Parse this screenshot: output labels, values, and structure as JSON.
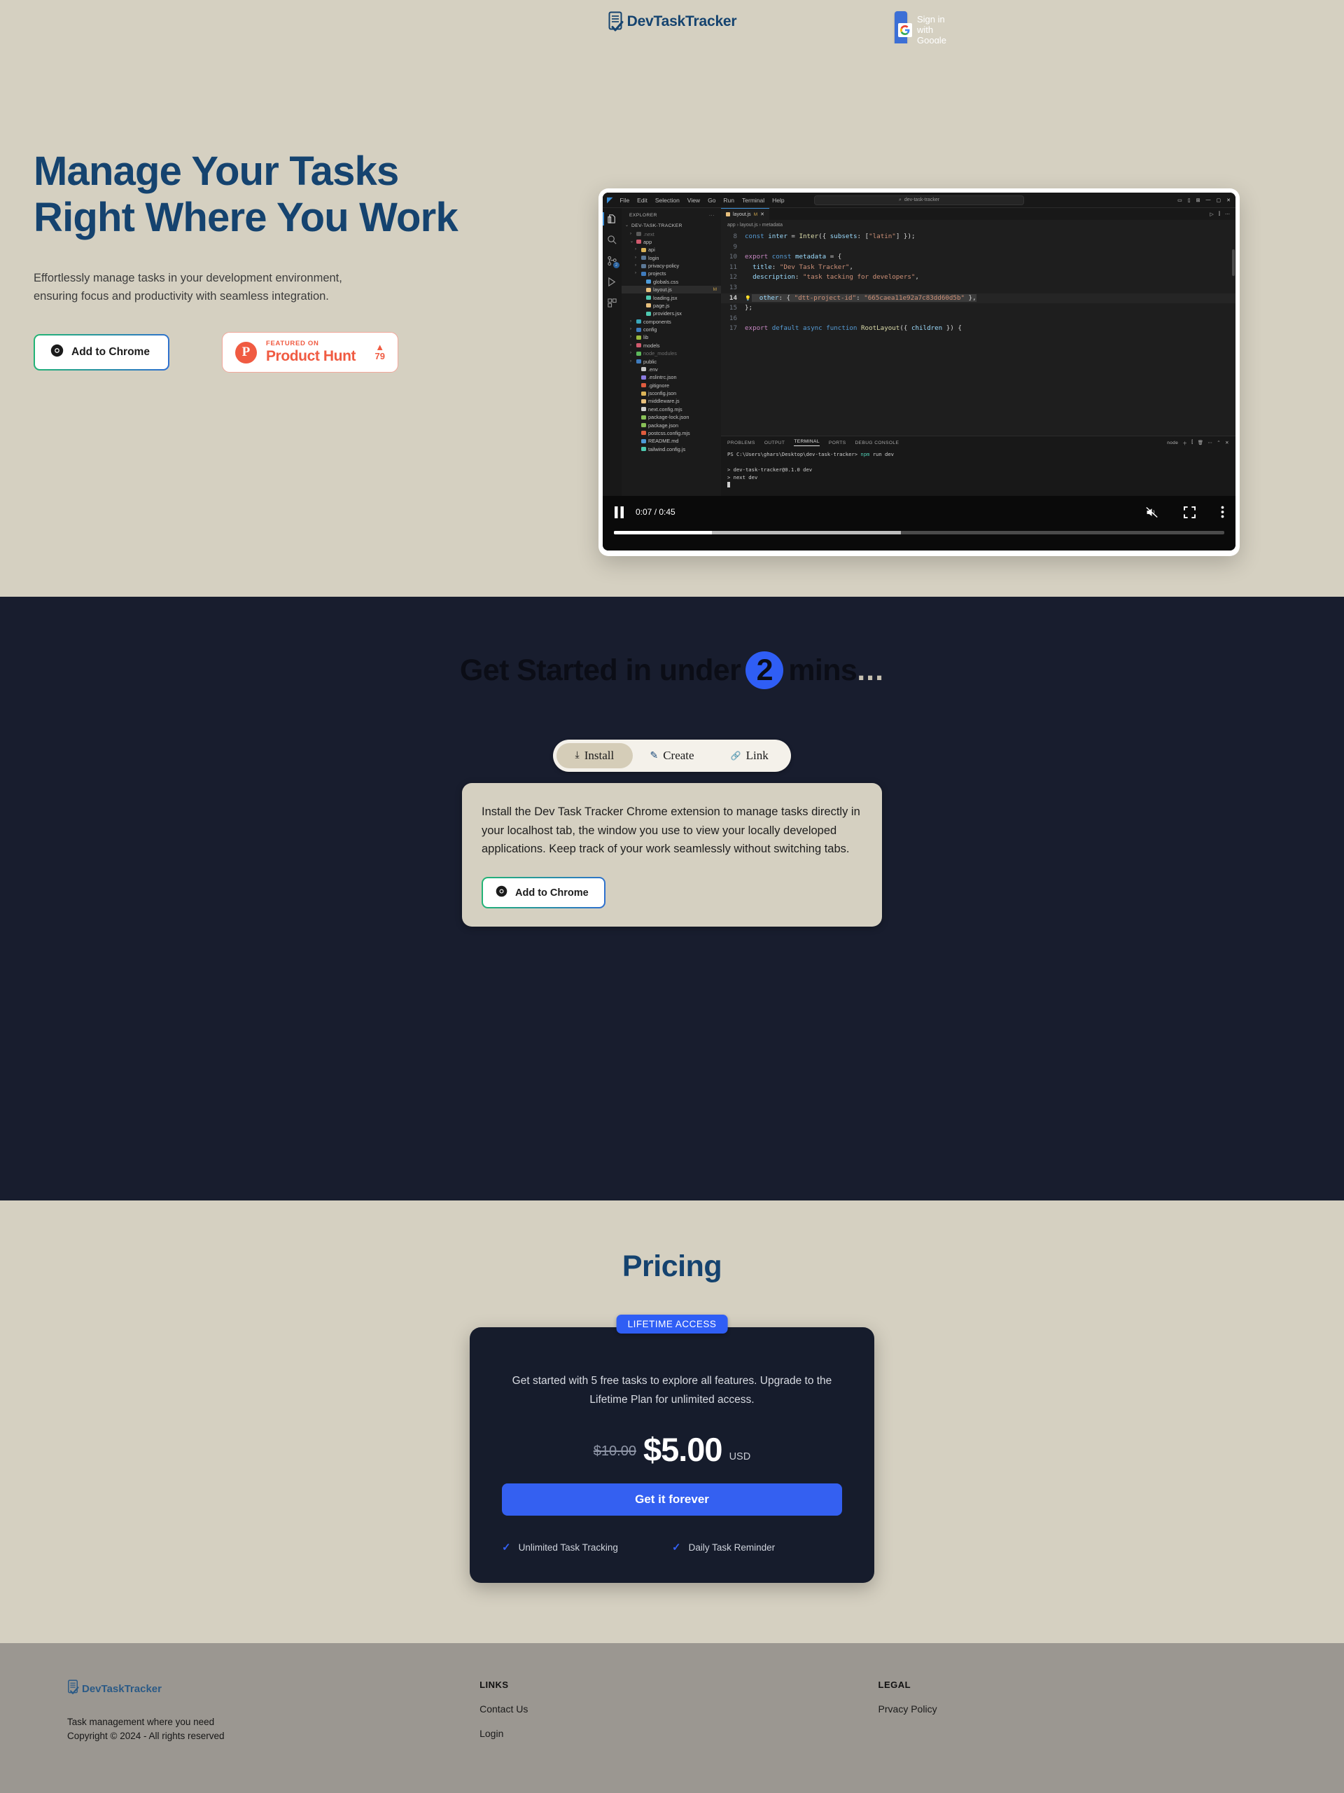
{
  "header": {
    "brand": "DevTaskTracker",
    "google_button": "Sign in with Google"
  },
  "hero": {
    "title_line1": "Manage Your Tasks",
    "title_line2": "Right Where You Work",
    "subtitle_line1": "Effortlessly manage tasks in your development environment,",
    "subtitle_line2": "ensuring focus and productivity with seamless integration.",
    "chrome_button": "Add to Chrome",
    "product_hunt": {
      "featured_on": "FEATURED ON",
      "name": "Product Hunt",
      "votes": "79",
      "triangle": "▲"
    }
  },
  "video": {
    "time": "0:07 / 0:45",
    "played_percent": 16,
    "buffered_percent": 47,
    "editor": {
      "menu": [
        "File",
        "Edit",
        "Selection",
        "View",
        "Go",
        "Run",
        "Terminal",
        "Help"
      ],
      "search_placeholder": "dev-task-tracker",
      "explorer_label": "EXPLORER",
      "explorer_more": "···",
      "root": "DEV-TASK-TRACKER",
      "tree": [
        {
          "indent": 1,
          "chev": "›",
          "color": "#5a5a5a",
          "label": ".next",
          "dim": true,
          "mod": ""
        },
        {
          "indent": 1,
          "chev": "⌄",
          "color": "#d15a6e",
          "label": "app",
          "dim": false,
          "mod": ""
        },
        {
          "indent": 2,
          "chev": "›",
          "color": "#dcb457",
          "label": "api",
          "dim": false,
          "mod": ""
        },
        {
          "indent": 2,
          "chev": "›",
          "color": "#5b7896",
          "label": "login",
          "dim": false,
          "mod": ""
        },
        {
          "indent": 2,
          "chev": "›",
          "color": "#5b7896",
          "label": "privacy-policy",
          "dim": false,
          "mod": ""
        },
        {
          "indent": 2,
          "chev": "›",
          "color": "#3f7bbd",
          "label": "projects",
          "dim": false,
          "mod": ""
        },
        {
          "indent": 3,
          "chev": "",
          "color": "#4d9bd8",
          "label": "globals.css",
          "dim": false,
          "mod": ""
        },
        {
          "indent": 3,
          "chev": "",
          "color": "#e8c07d",
          "label": "layout.js",
          "dim": false,
          "mod": "M",
          "selected": true
        },
        {
          "indent": 3,
          "chev": "",
          "color": "#4ec9b0",
          "label": "loading.jsx",
          "dim": false,
          "mod": ""
        },
        {
          "indent": 3,
          "chev": "",
          "color": "#e8c07d",
          "label": "page.js",
          "dim": false,
          "mod": ""
        },
        {
          "indent": 3,
          "chev": "",
          "color": "#4ec9b0",
          "label": "providers.jsx",
          "dim": false,
          "mod": ""
        },
        {
          "indent": 1,
          "chev": "›",
          "color": "#3aa6b9",
          "label": "components",
          "dim": false,
          "mod": ""
        },
        {
          "indent": 1,
          "chev": "›",
          "color": "#3f7bbd",
          "label": "config",
          "dim": false,
          "mod": ""
        },
        {
          "indent": 1,
          "chev": "›",
          "color": "#9aba3e",
          "label": "lib",
          "dim": false,
          "mod": ""
        },
        {
          "indent": 1,
          "chev": "›",
          "color": "#d15a6e",
          "label": "models",
          "dim": false,
          "mod": ""
        },
        {
          "indent": 1,
          "chev": "›",
          "color": "#5cb85c",
          "label": "node_modules",
          "dim": true,
          "mod": ""
        },
        {
          "indent": 1,
          "chev": "›",
          "color": "#3f7bbd",
          "label": "public",
          "dim": false,
          "mod": ""
        },
        {
          "indent": 2,
          "chev": "",
          "color": "#c7c7c7",
          "label": ".env",
          "dim": false,
          "mod": ""
        },
        {
          "indent": 2,
          "chev": "",
          "color": "#8a7ae0",
          "label": ".eslintrc.json",
          "dim": false,
          "mod": ""
        },
        {
          "indent": 2,
          "chev": "",
          "color": "#e05c3e",
          "label": ".gitignore",
          "dim": false,
          "mod": ""
        },
        {
          "indent": 2,
          "chev": "",
          "color": "#dcb457",
          "label": "jsconfig.json",
          "dim": false,
          "mod": ""
        },
        {
          "indent": 2,
          "chev": "",
          "color": "#e8c07d",
          "label": "middleware.js",
          "dim": false,
          "mod": ""
        },
        {
          "indent": 2,
          "chev": "",
          "color": "#cfcfcf",
          "label": "next.config.mjs",
          "dim": false,
          "mod": ""
        },
        {
          "indent": 2,
          "chev": "",
          "color": "#88c057",
          "label": "package-lock.json",
          "dim": false,
          "mod": ""
        },
        {
          "indent": 2,
          "chev": "",
          "color": "#88c057",
          "label": "package.json",
          "dim": false,
          "mod": ""
        },
        {
          "indent": 2,
          "chev": "",
          "color": "#e05c3e",
          "label": "postcss.config.mjs",
          "dim": false,
          "mod": ""
        },
        {
          "indent": 2,
          "chev": "",
          "color": "#4d9bd8",
          "label": "README.md",
          "dim": false,
          "mod": ""
        },
        {
          "indent": 2,
          "chev": "",
          "color": "#4ec9b0",
          "label": "tailwind.config.js",
          "dim": false,
          "mod": ""
        }
      ],
      "tab_name": "layout.js",
      "tab_modified": "M",
      "tab_close": "✕",
      "breadcrumb": "app  ›  layout.js  ›  metadata",
      "code_lines": [
        {
          "n": "8",
          "segments": [
            {
              "t": "const ",
              "c": "kw"
            },
            {
              "t": "inter",
              "c": "v"
            },
            {
              "t": " = ",
              "c": "p"
            },
            {
              "t": "Inter",
              "c": "fn"
            },
            {
              "t": "({ ",
              "c": "p"
            },
            {
              "t": "subsets",
              "c": "v"
            },
            {
              "t": ": [",
              "c": "p"
            },
            {
              "t": "\"latin\"",
              "c": "s"
            },
            {
              "t": "] });",
              "c": "p"
            }
          ]
        },
        {
          "n": "9",
          "segments": []
        },
        {
          "n": "10",
          "segments": [
            {
              "t": "export ",
              "c": "k"
            },
            {
              "t": "const ",
              "c": "kw"
            },
            {
              "t": "metadata",
              "c": "v"
            },
            {
              "t": " = {",
              "c": "p"
            }
          ]
        },
        {
          "n": "11",
          "segments": [
            {
              "t": "  title",
              "c": "v"
            },
            {
              "t": ": ",
              "c": "p"
            },
            {
              "t": "\"Dev Task Tracker\"",
              "c": "s"
            },
            {
              "t": ",",
              "c": "p"
            }
          ]
        },
        {
          "n": "12",
          "segments": [
            {
              "t": "  description",
              "c": "v"
            },
            {
              "t": ": ",
              "c": "p"
            },
            {
              "t": "\"task tacking for developers\"",
              "c": "s"
            },
            {
              "t": ",",
              "c": "p"
            }
          ]
        },
        {
          "n": "13",
          "segments": []
        },
        {
          "n": "14",
          "current": true,
          "bulb": "●",
          "segments": [
            {
              "t": "  other",
              "c": "v hl"
            },
            {
              "t": ": { ",
              "c": "p hl"
            },
            {
              "t": "\"dtt-project-id\"",
              "c": "s hl"
            },
            {
              "t": ": ",
              "c": "p hl"
            },
            {
              "t": "\"665caea11e92a7c83dd60d5b\"",
              "c": "s hl"
            },
            {
              "t": " },",
              "c": "p hl"
            }
          ]
        },
        {
          "n": "15",
          "segments": [
            {
              "t": "};",
              "c": "p"
            }
          ]
        },
        {
          "n": "16",
          "segments": []
        },
        {
          "n": "17",
          "segments": [
            {
              "t": "export ",
              "c": "k"
            },
            {
              "t": "default ",
              "c": "kw"
            },
            {
              "t": "async ",
              "c": "kw"
            },
            {
              "t": "function ",
              "c": "kw"
            },
            {
              "t": "RootLayout",
              "c": "fn"
            },
            {
              "t": "({ ",
              "c": "p"
            },
            {
              "t": "children",
              "c": "v"
            },
            {
              "t": " }) {",
              "c": "p"
            }
          ]
        }
      ],
      "panel_tabs": [
        "PROBLEMS",
        "OUTPUT",
        "TERMINAL",
        "PORTS",
        "DEBUG CONSOLE"
      ],
      "panel_active": "TERMINAL",
      "panel_right": "node",
      "terminal_lines": [
        "PS C:\\Users\\ghars\\Desktop\\dev-task-tracker> npm run dev",
        "",
        "> dev-task-tracker@0.1.0 dev",
        "> next dev"
      ]
    }
  },
  "get_started": {
    "title_before": "Get Started in under",
    "highlight": "2",
    "title_after": "mins",
    "dots": "...",
    "tabs": [
      {
        "label": "Install",
        "icon": "download-icon",
        "glyph": "⤓",
        "active": true
      },
      {
        "label": "Create",
        "icon": "pencil-icon",
        "glyph": "✎",
        "active": false
      },
      {
        "label": "Link",
        "icon": "link-icon",
        "glyph": "🔗",
        "active": false
      }
    ],
    "panel_text": "Install the Dev Task Tracker Chrome extension to manage tasks directly in your localhost tab, the window you use to view your locally developed applications. Keep track of your work seamlessly without switching tabs.",
    "panel_button": "Add to Chrome"
  },
  "pricing": {
    "title": "Pricing",
    "badge": "LIFETIME ACCESS",
    "description": "Get started with 5 free tasks to explore all features. Upgrade to the Lifetime Plan for unlimited access.",
    "price_old": "$10.00",
    "price_new": "$5.00",
    "currency": "USD",
    "cta": "Get it forever",
    "features": [
      "Unlimited Task Tracking",
      "Daily Task Reminder"
    ],
    "check": "✓"
  },
  "footer": {
    "brand": "DevTaskTracker",
    "tagline_line1": "Task management where you need",
    "tagline_line2": "Copyright © 2024 - All rights reserved",
    "links_heading": "LINKS",
    "links": [
      "Contact Us",
      "Login"
    ],
    "legal_heading": "LEGAL",
    "legal": [
      "Prvacy Policy"
    ]
  },
  "colors": {
    "cream": "#d5d0c1",
    "navy": "#15436f",
    "dark_section": "#181d2e",
    "accent_blue": "#2f5ef5",
    "product_hunt_red": "#f05b42",
    "footer_gray": "#9b9791"
  }
}
